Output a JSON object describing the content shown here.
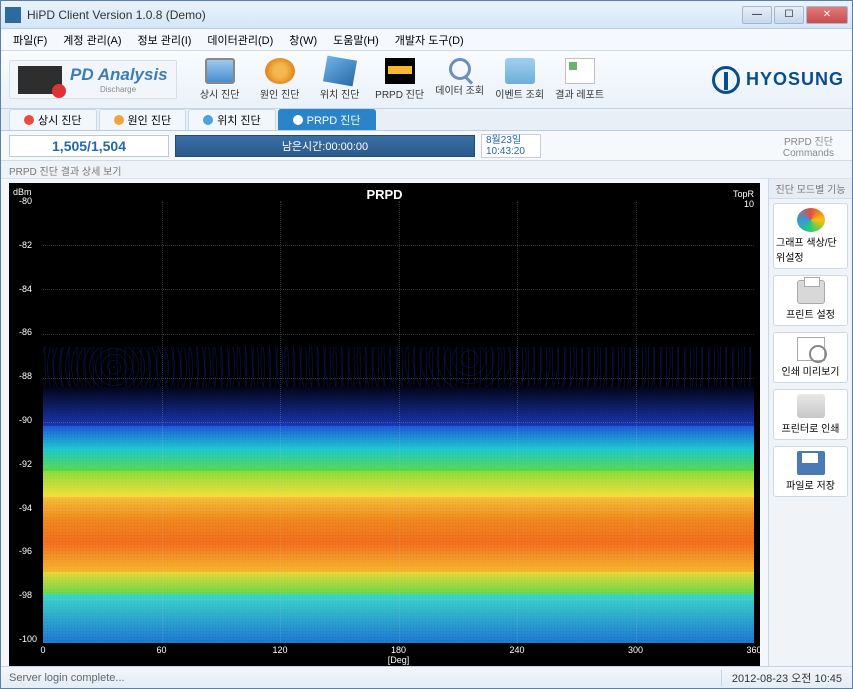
{
  "window": {
    "title": "HiPD Client Version 1.0.8 (Demo)"
  },
  "menu": [
    "파일(F)",
    "계정 관리(A)",
    "정보 관리(I)",
    "데이터관리(D)",
    "창(W)",
    "도움말(H)",
    "개발자 도구(D)"
  ],
  "pd": {
    "title": "PD Analysis",
    "sub": "Discharge"
  },
  "toolbar": [
    {
      "label": "상시 진단"
    },
    {
      "label": "원인 진단"
    },
    {
      "label": "위치 진단"
    },
    {
      "label": "PRPD 진단"
    },
    {
      "label": "데이터 조회"
    },
    {
      "label": "이벤트 조회"
    },
    {
      "label": "결과 레포트"
    }
  ],
  "logo": "HYOSUNG",
  "tabs": [
    {
      "label": "상시 진단",
      "active": false,
      "color": "#e74c3c"
    },
    {
      "label": "원인 진단",
      "active": false,
      "color": "#f1a33c"
    },
    {
      "label": "위치 진단",
      "active": false,
      "color": "#4aa3e0"
    },
    {
      "label": "PRPD 진단",
      "active": true,
      "color": "#fff"
    }
  ],
  "status": {
    "counter": "1,505/1,504",
    "remain": "남은시간:00:00:00",
    "date_top": "8월23일",
    "date_bot": "10:43:20",
    "cmd_top": "PRPD 진단",
    "cmd_bot": "Commands"
  },
  "subheader": "PRPD  진단 결과 상세 보기",
  "chart": {
    "title": "PRPD",
    "y_unit": "dBm",
    "topR_lbl": "TopR",
    "topR_val": "10",
    "y_ticks": [
      "-80",
      "-82",
      "-84",
      "-86",
      "-88",
      "-90",
      "-92",
      "-94",
      "-96",
      "-98",
      "-100"
    ],
    "x_ticks": [
      "0",
      "60",
      "120",
      "180",
      "240",
      "300",
      "360"
    ],
    "x_unit": "[Deg]"
  },
  "side_header": "진단 모드별 기능",
  "side": [
    {
      "label": "그래프 색상/단위설정"
    },
    {
      "label": "프린트 설정"
    },
    {
      "label": "인쇄 미리보기"
    },
    {
      "label": "프린터로 인쇄"
    },
    {
      "label": "파일로 저장"
    }
  ],
  "statusbar": {
    "msg": "Server login complete...",
    "clock": "2012-08-23 오전 10:45"
  },
  "chart_data": {
    "type": "heatmap",
    "title": "PRPD",
    "xlabel": "[Deg]",
    "ylabel": "dBm",
    "xlim": [
      0,
      360
    ],
    "ylim": [
      -100,
      -80
    ],
    "x_ticks": [
      0,
      60,
      120,
      180,
      240,
      300,
      360
    ],
    "y_ticks": [
      -80,
      -82,
      -84,
      -86,
      -88,
      -90,
      -92,
      -94,
      -96,
      -98,
      -100
    ],
    "density_bands": [
      {
        "dbm_from": -80,
        "dbm_to": -86,
        "density": 0,
        "color": "none"
      },
      {
        "dbm_from": -86,
        "dbm_to": -88,
        "density": 2,
        "color": "sparse-darkblue"
      },
      {
        "dbm_from": -88,
        "dbm_to": -90,
        "density": 15,
        "color": "blue"
      },
      {
        "dbm_from": -90,
        "dbm_to": -91,
        "density": 40,
        "color": "cyan"
      },
      {
        "dbm_from": -91,
        "dbm_to": -92,
        "density": 60,
        "color": "green"
      },
      {
        "dbm_from": -92,
        "dbm_to": -93,
        "density": 80,
        "color": "yellow"
      },
      {
        "dbm_from": -93,
        "dbm_to": -97,
        "density": 100,
        "color": "orange-red"
      },
      {
        "dbm_from": -97,
        "dbm_to": -98,
        "density": 70,
        "color": "yellow-green"
      },
      {
        "dbm_from": -98,
        "dbm_to": -100,
        "density": 50,
        "color": "cyan-blue"
      }
    ],
    "phase_uniformity": "uniform across 0–360 deg (noise floor, no phase-correlated PD clusters)",
    "colorbar_label": "TopR",
    "colorbar_max": 10
  }
}
